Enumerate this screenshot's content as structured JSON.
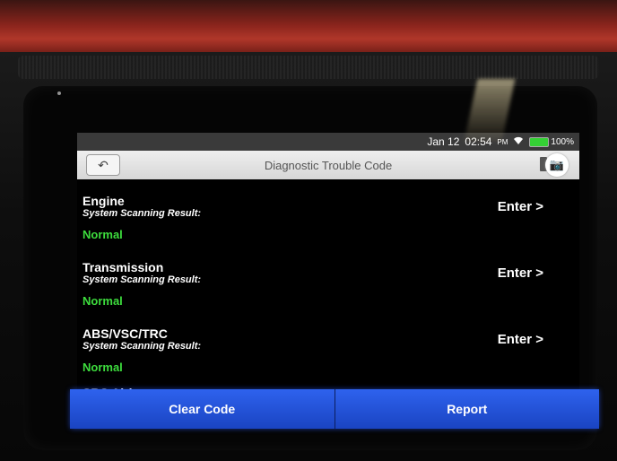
{
  "status_bar": {
    "date": "Jan 12",
    "time": "02:54",
    "ampm": "PM",
    "battery": "100%",
    "battery_color": "#35d135"
  },
  "header": {
    "title": "Diagnostic Trouble Code",
    "back_icon": "back-arrow-icon",
    "camera_icon": "camera-icon"
  },
  "systems": [
    {
      "name": "Engine",
      "result_label": "System Scanning Result:",
      "status": "Normal",
      "enter": "Enter >"
    },
    {
      "name": "Transmission",
      "result_label": "System Scanning Result:",
      "status": "Normal",
      "enter": "Enter >"
    },
    {
      "name": "ABS/VSC/TRC",
      "result_label": "System Scanning Result:",
      "status": "Normal",
      "enter": "Enter >"
    }
  ],
  "partial_system": "SRS Airbag",
  "actions": {
    "clear_code": "Clear Code",
    "report": "Report"
  },
  "colors": {
    "status_normal": "#3ddc3d",
    "action_blue": "#1f4fd4"
  }
}
